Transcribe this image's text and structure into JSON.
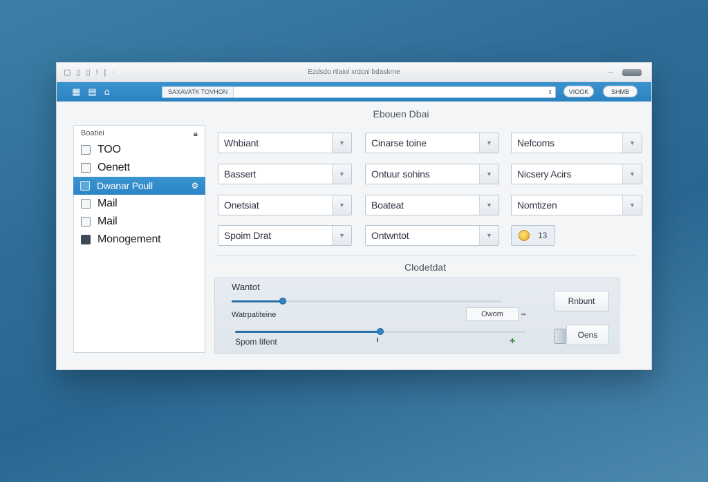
{
  "window": {
    "title": "Ezdsdo rtlaiol xrdcni bdaskrne"
  },
  "toolbar": {
    "search_tag": "SAXAVATK TOVHON",
    "search_placeholder": "",
    "btn_view": "VIOOK",
    "btn_share": "SHMB"
  },
  "content": {
    "title": "Ebouen Dbai"
  },
  "sidebar": {
    "header": "Boatiei",
    "items": [
      {
        "label": "TOO"
      },
      {
        "label": "Oenett"
      },
      {
        "label": "Dwanar Poull"
      },
      {
        "label": "Mail"
      },
      {
        "label": "Mail"
      },
      {
        "label": "Monogement"
      }
    ]
  },
  "dropdowns": [
    {
      "value": "Whbiant"
    },
    {
      "value": "Cinarse toine"
    },
    {
      "value": "Nefcoms"
    },
    {
      "value": "Bassert"
    },
    {
      "value": "Ontuur sohins"
    },
    {
      "value": "Nicsery Acirs"
    },
    {
      "value": "Onetsiat"
    },
    {
      "value": "Boateat"
    },
    {
      "value": "Nomtizen"
    },
    {
      "value": "Spoim Drat"
    },
    {
      "value": "Ontwntot"
    }
  ],
  "counter": {
    "value": "13"
  },
  "section": {
    "title": "Clodetdat",
    "label_top": "Wantot",
    "slider1_value": 0.19,
    "label_mid": "Watrpatiteine",
    "option_value": "Owom",
    "slider2_value": 0.5,
    "label_bottom": "Spom Iifent"
  },
  "buttons": {
    "primary": "Rnbunt",
    "secondary": "Oens"
  },
  "colors": {
    "accent": "#2b84c4",
    "window_bg": "#f3f5f7"
  }
}
